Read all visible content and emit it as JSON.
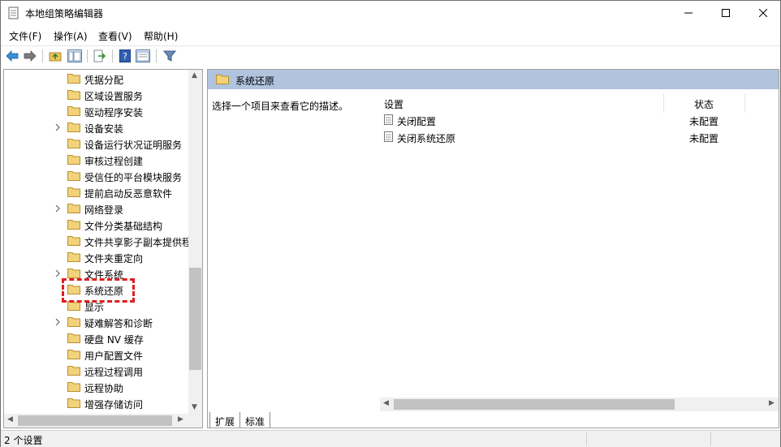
{
  "window": {
    "title": "本地组策略编辑器"
  },
  "menu": [
    {
      "label": "文件(F)"
    },
    {
      "label": "操作(A)"
    },
    {
      "label": "查看(V)"
    },
    {
      "label": "帮助(H)"
    }
  ],
  "toolbar": {
    "buttons": [
      "back-icon",
      "forward-icon",
      "up-folder-icon",
      "show-hide-tree-icon",
      "export-list-icon",
      "help-icon",
      "properties-icon",
      "filter-icon"
    ]
  },
  "tree": {
    "items": [
      {
        "label": "凭据分配",
        "expandable": false
      },
      {
        "label": "区域设置服务",
        "expandable": false
      },
      {
        "label": "驱动程序安装",
        "expandable": false
      },
      {
        "label": "设备安装",
        "expandable": true
      },
      {
        "label": "设备运行状况证明服务",
        "expandable": false
      },
      {
        "label": "审核过程创建",
        "expandable": false
      },
      {
        "label": "受信任的平台模块服务",
        "expandable": false
      },
      {
        "label": "提前启动反恶意软件",
        "expandable": false
      },
      {
        "label": "网络登录",
        "expandable": true
      },
      {
        "label": "文件分类基础结构",
        "expandable": false
      },
      {
        "label": "文件共享影子副本提供程",
        "expandable": false
      },
      {
        "label": "文件夹重定向",
        "expandable": false
      },
      {
        "label": "文件系统",
        "expandable": true
      },
      {
        "label": "系统还原",
        "expandable": false,
        "selected": true
      },
      {
        "label": "显示",
        "expandable": false
      },
      {
        "label": "疑难解答和诊断",
        "expandable": true
      },
      {
        "label": "硬盘 NV 缓存",
        "expandable": false
      },
      {
        "label": "用户配置文件",
        "expandable": false
      },
      {
        "label": "远程过程调用",
        "expandable": false
      },
      {
        "label": "远程协助",
        "expandable": false
      },
      {
        "label": "增强存储访问",
        "expandable": false
      }
    ]
  },
  "right": {
    "header": "系统还原",
    "description": "选择一个项目来查看它的描述。",
    "columns": {
      "setting": "设置",
      "state": "状态"
    },
    "rows": [
      {
        "name": "关闭配置",
        "state": "未配置"
      },
      {
        "name": "关闭系统还原",
        "state": "未配置"
      }
    ],
    "tabs": [
      "扩展",
      "标准"
    ]
  },
  "status": {
    "text": "2 个设置"
  },
  "colors": {
    "header_bg": "#b0c4de",
    "highlight": "#e01e1e",
    "folder": "#e8c45c"
  }
}
